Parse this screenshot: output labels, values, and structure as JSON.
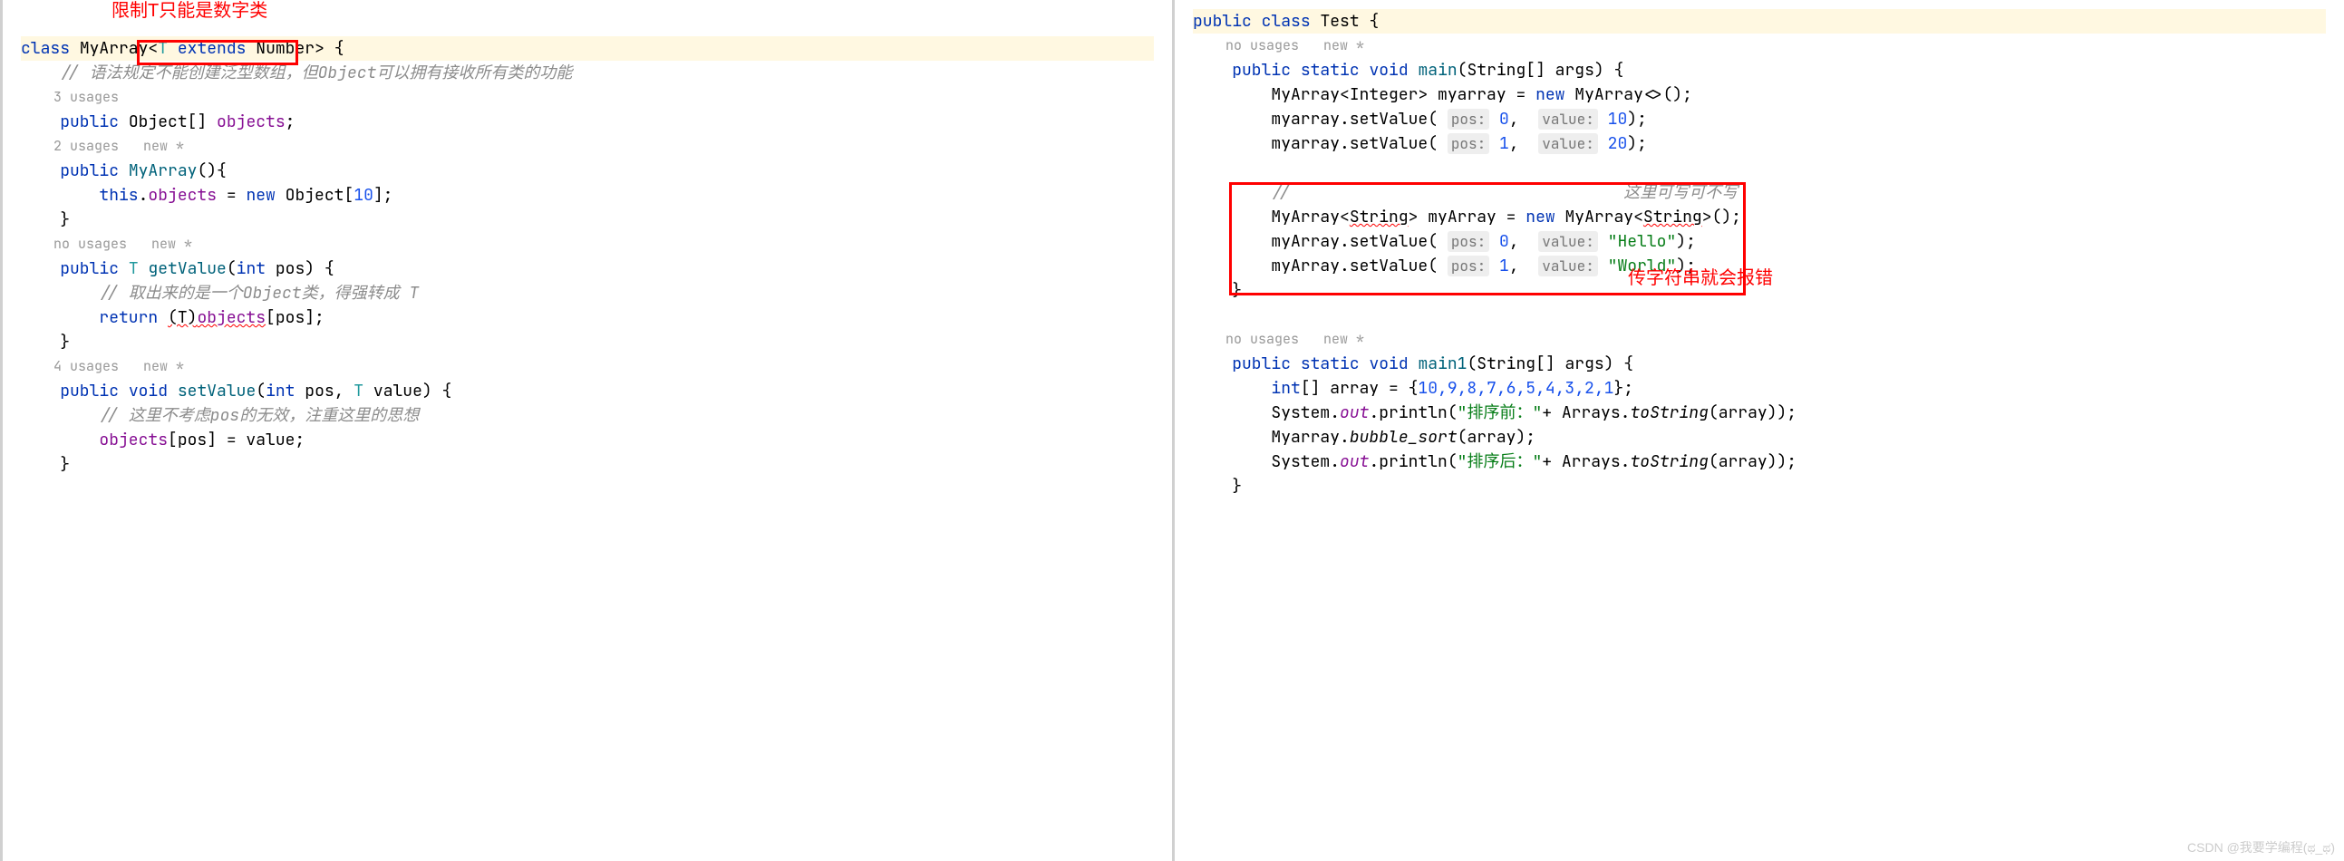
{
  "annotations": {
    "top_red": "限制T只能是数字类",
    "right_red": "传字符串就会报错",
    "inline_comment": "这里可写可不写"
  },
  "left": {
    "class_kw": "class",
    "class_name": "MyArray",
    "generic_open": "<",
    "generic_t": "T",
    "extends_kw": "extends",
    "number_type": "Number",
    "generic_close": ">",
    "brace_open": " {",
    "comment1": "// 语法规定不能创建泛型数组，但Object可以拥有接收所有类的功能",
    "usages3": "3 usages",
    "public_kw": "public",
    "object_arr": "Object[]",
    "objects_field": "objects",
    "semi": ";",
    "usages2_new": "2 usages   new *",
    "ctor_name": "MyArray",
    "ctor_params": "(){",
    "this_kw": "this",
    "dot": ".",
    "assign": " = ",
    "new_kw": "new",
    "obj_new": "Object[",
    "ten": "10",
    "close_bracket": "];",
    "brace_close": "}",
    "nousages_new": "no usages   new *",
    "t_type": "T",
    "getValue": "getValue",
    "int_kw": "int",
    "pos_param": " pos) {",
    "comment2": "// 取出来的是一个Object类，得强转成 T",
    "return_kw": "return",
    "cast_t": "(T)",
    "objects_ref": "objects",
    "pos_idx": "[pos];",
    "usages4_new": "4 usages   new *",
    "void_kw": "void",
    "setValue": "setValue",
    "setValue_params_open": "(",
    "pos_comma": " pos, ",
    "value_param": " value) {",
    "comment3": "// 这里不考虑pos的无效，注重这里的思想",
    "assign_stmt_left": "objects",
    "assign_stmt_idx": "[pos] = value;"
  },
  "right": {
    "public_kw": "public",
    "class_kw": "class",
    "test_name": "Test",
    "brace": " {",
    "nousages_new": "no usages   new *",
    "static_kw": "static",
    "void_kw": "void",
    "main": "main",
    "main_params": "(String[] args) {",
    "myarray_type": "MyArray",
    "integer": "Integer",
    "myarray_var": " myarray = ",
    "new_kw": "new",
    "diamond": "<>();",
    "setval_call": ".setValue(",
    "pos_hint": "pos:",
    "zero": "0",
    "comma_sp": ",  ",
    "value_hint": "value:",
    "v10": "10",
    "close_call": ");",
    "one": "1",
    "v20": "20",
    "comment_slash": "//",
    "string_type": "String",
    "myArray2_var": " myArray = ",
    "string_gen": "<String>",
    "hello": "\"Hello\"",
    "world": "\"World\"",
    "brace_close": "}",
    "main1": "main1",
    "int_kw": "int",
    "arr_decl": "[] array = {",
    "arr_vals": "10,9,8,7,6,5,4,3,2,1",
    "arr_close": "};",
    "system": "System",
    "out": "out",
    "println": ".println(",
    "sort_before": "\"排序前：\"",
    "plus": "+ ",
    "arrays": "Arrays",
    "tostring": "toString",
    "array_arg": "(array));",
    "myarray_static": "Myarray",
    "bubble": "bubble_sort",
    "bubble_arg": "(array);",
    "sort_after": "\"排序后：\""
  },
  "watermark": "CSDN @我要学编程(ಥ_ಥ)"
}
